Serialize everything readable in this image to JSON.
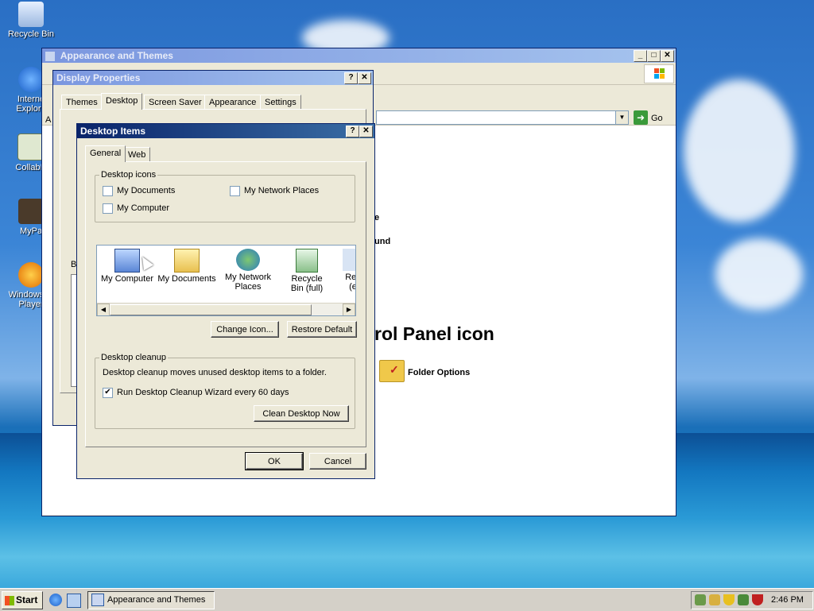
{
  "desktop": {
    "icons": [
      {
        "label": "Recycle Bin"
      },
      {
        "label": "Interne Explore"
      },
      {
        "label": "CollabN"
      },
      {
        "label": "MyPa"
      },
      {
        "label": "Windows M Player"
      }
    ]
  },
  "appearance_window": {
    "title": "Appearance and Themes",
    "address_go": "Go",
    "partial_text_1": "e",
    "partial_text_2": "und",
    "heading_partial": "rol Panel icon",
    "folder_options": "Folder Options"
  },
  "display_properties": {
    "title": "Display Properties",
    "tabs": [
      "Themes",
      "Desktop",
      "Screen Saver",
      "Appearance",
      "Settings"
    ],
    "selected_tab": "Desktop",
    "left_partial_1": "A",
    "left_partial_2": "B"
  },
  "desktop_items": {
    "title": "Desktop Items",
    "tabs": [
      "General",
      "Web"
    ],
    "desktop_icons_group": "Desktop icons",
    "checkboxes": {
      "my_documents": {
        "label": "My Documents",
        "checked": false
      },
      "my_network_places": {
        "label": "My Network Places",
        "checked": false
      },
      "my_computer": {
        "label": "My Computer",
        "checked": false
      }
    },
    "icon_list": [
      {
        "label": "My Computer",
        "icon": "my-computer-icon"
      },
      {
        "label": "My Documents",
        "icon": "my-documents-icon"
      },
      {
        "label": "My Network Places",
        "icon": "network-places-icon"
      },
      {
        "label": "Recycle Bin (full)",
        "icon": "recycle-bin-full-icon"
      },
      {
        "label": "Rec (e",
        "icon": "recycle-bin-empty-icon"
      }
    ],
    "change_icon_button": "Change Icon...",
    "restore_default_button": "Restore Default",
    "cleanup_group": "Desktop cleanup",
    "cleanup_description": "Desktop cleanup moves unused desktop items to a folder.",
    "run_wizard": {
      "label": "Run Desktop Cleanup Wizard every 60 days",
      "checked": true
    },
    "clean_now_button": "Clean Desktop Now",
    "ok_button": "OK",
    "cancel_button": "Cancel",
    "help_glyph": "?",
    "close_glyph": "✕"
  },
  "taskbar": {
    "start_label": "Start",
    "task_label": "Appearance and Themes",
    "clock": "2:46 PM"
  }
}
